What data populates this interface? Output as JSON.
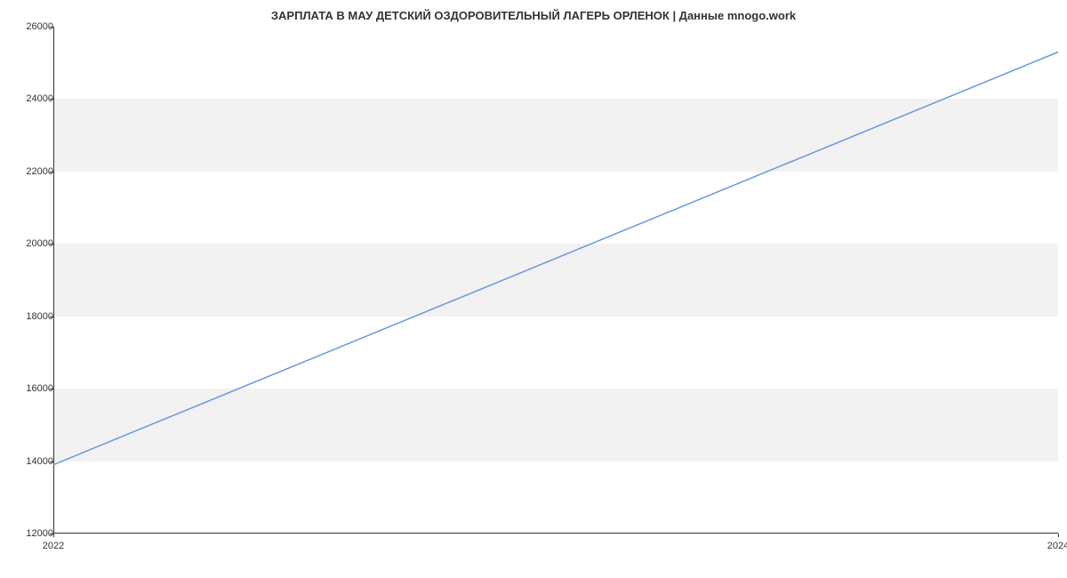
{
  "chart_data": {
    "type": "line",
    "title": "ЗАРПЛАТА В МАУ  ДЕТСКИЙ ОЗДОРОВИТЕЛЬНЫЙ ЛАГЕРЬ ОРЛЕНОК | Данные mnogo.work",
    "x": [
      2022,
      2024
    ],
    "values": [
      13900,
      25300
    ],
    "xlabel": "",
    "ylabel": "",
    "xlim": [
      2022,
      2024
    ],
    "ylim": [
      12000,
      26000
    ],
    "y_ticks": [
      12000,
      14000,
      16000,
      18000,
      20000,
      22000,
      24000,
      26000
    ],
    "x_ticks": [
      2022,
      2024
    ],
    "line_color": "#6699dd"
  }
}
